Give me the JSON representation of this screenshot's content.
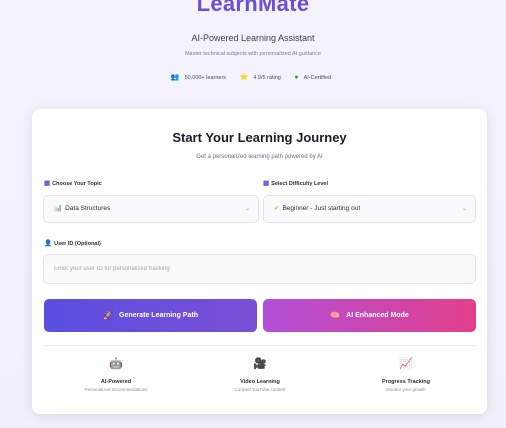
{
  "header": {
    "brand": "LearnMate",
    "tagline": "AI-Powered Learning Assistant",
    "subtagline": "Master technical subjects with personalized AI guidance",
    "stats": [
      {
        "icon": "people-icon",
        "glyph": "👥",
        "text": "50,000+ learners"
      },
      {
        "icon": "star-icon",
        "glyph": "⭐",
        "text": "4.9/5 rating"
      },
      {
        "icon": "ai-certified-icon",
        "glyph": "●",
        "text": "AI-Certified"
      }
    ]
  },
  "card": {
    "title": "Start Your Learning Journey",
    "subtitle": "Get a personalized learning path powered by AI",
    "topic": {
      "label": "Choose Your Topic",
      "icon": "book-icon",
      "glyph": "▦",
      "value": "Data Structures",
      "value_glyph": "📊"
    },
    "difficulty": {
      "label": "Select Difficulty Level",
      "icon": "level-icon",
      "glyph": "▦",
      "value": "Beginner - Just starting out",
      "value_glyph": "✔"
    },
    "user_id": {
      "label": "User ID (Optional)",
      "icon": "user-icon",
      "glyph": "👤",
      "placeholder": "Enter your user ID for personalized tracking"
    },
    "buttons": {
      "generate": {
        "label": "Generate Learning Path",
        "icon": "rocket-icon",
        "glyph": "🚀"
      },
      "ai_mode": {
        "label": "AI Enhanced Mode",
        "icon": "brain-icon",
        "glyph": "🧠"
      }
    },
    "features": [
      {
        "icon": "robot-icon",
        "glyph": "🤖",
        "title": "AI-Powered",
        "desc": "Personalized recommendations"
      },
      {
        "icon": "video-icon",
        "glyph": "🎥",
        "title": "Video Learning",
        "desc": "Curated YouTube content"
      },
      {
        "icon": "chart-icon",
        "glyph": "📈",
        "title": "Progress Tracking",
        "desc": "Monitor your growth"
      }
    ]
  },
  "colors": {
    "brand": "#6b4fd6",
    "primary_button": "#5a4fe0",
    "ai_button_start": "#b24fd8",
    "ai_button_end": "#e23f8a",
    "feature_robot": "#6b4fd6",
    "feature_video": "#22a559",
    "feature_chart": "#7a4fd6"
  }
}
